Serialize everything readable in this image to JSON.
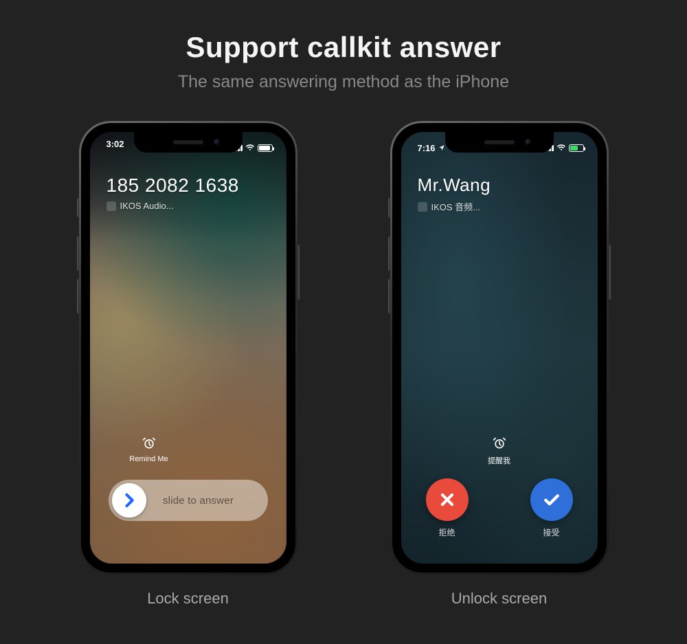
{
  "title": "Support callkit answer",
  "subtitle": "The same answering method as the iPhone",
  "phones": {
    "lock": {
      "caption": "Lock screen",
      "time": "3:02",
      "caller": "185 2082 1638",
      "source": "IKOS Audio...",
      "remind_label": "Remind Me",
      "slide_label": "slide to answer"
    },
    "unlock": {
      "caption": "Unlock screen",
      "time": "7:16",
      "caller": "Mr.Wang",
      "source": "IKOS 音频...",
      "remind_label": "提醒我",
      "decline_label": "拒绝",
      "accept_label": "接受"
    }
  }
}
